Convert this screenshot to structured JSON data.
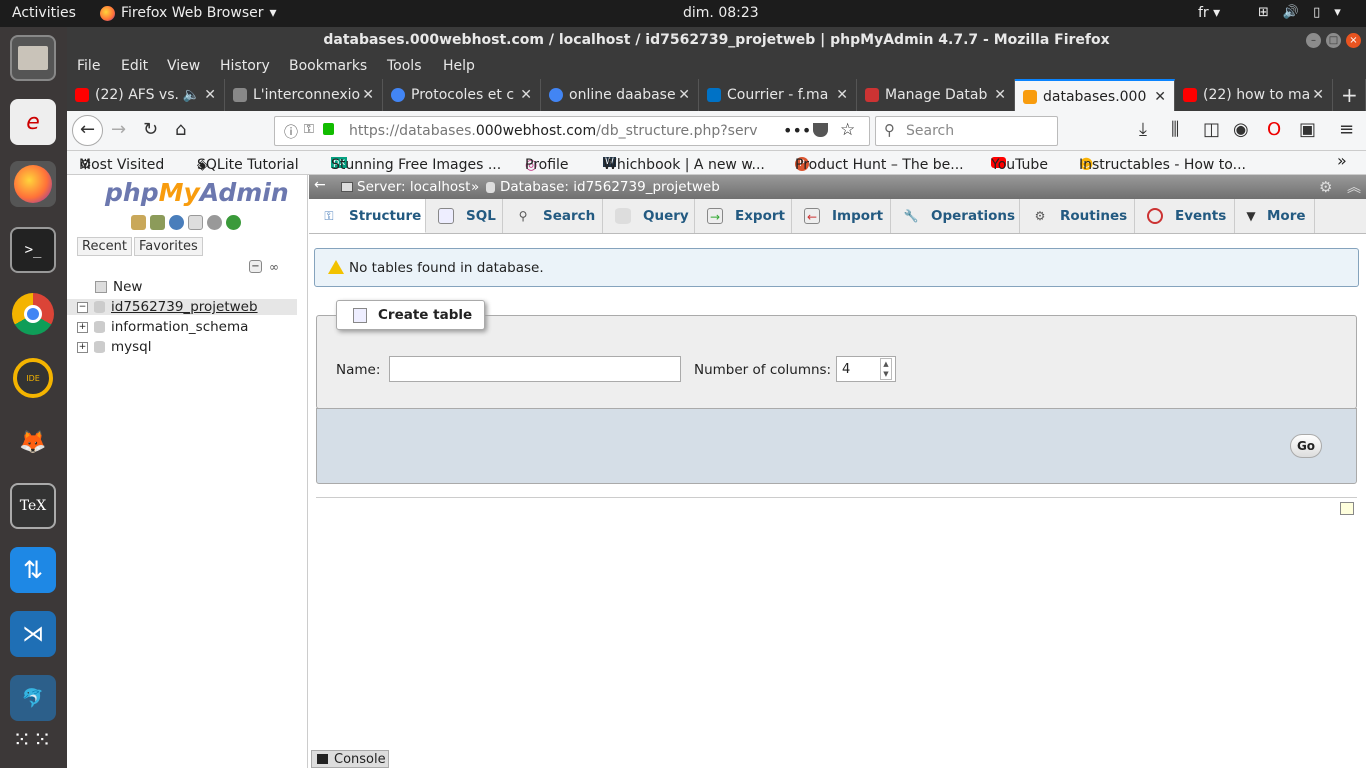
{
  "system": {
    "activities": "Activities",
    "app_name": "Firefox Web Browser",
    "clock": "dim. 08:23",
    "lang": "fr"
  },
  "window": {
    "title": "databases.000webhost.com / localhost / id7562739_projetweb | phpMyAdmin 4.7.7 - Mozilla Firefox"
  },
  "menu": [
    "File",
    "Edit",
    "View",
    "History",
    "Bookmarks",
    "Tools",
    "Help"
  ],
  "tabs": [
    {
      "label": "(22) AFS vs.",
      "icon_color": "#ff0000",
      "icon": "youtube-icon"
    },
    {
      "label": "L'interconnexio",
      "icon_color": "#888888",
      "icon": "page-icon"
    },
    {
      "label": "Protocoles et c",
      "icon_color": "#4285f4",
      "icon": "google-icon"
    },
    {
      "label": "online daabase",
      "icon_color": "#4285f4",
      "icon": "google-icon"
    },
    {
      "label": "Courrier - f.ma",
      "icon_color": "#0072c6",
      "icon": "outlook-icon"
    },
    {
      "label": "Manage Datab",
      "icon_color": "#cc3333",
      "icon": "page-icon"
    },
    {
      "label": "databases.000",
      "icon_color": "#f89c0e",
      "icon": "phpmyadmin-icon"
    },
    {
      "label": "(22) how to ma",
      "icon_color": "#ff0000",
      "icon": "youtube-icon"
    }
  ],
  "nav": {
    "url_prefix": "https://databases.",
    "url_host": "000webhost.com",
    "url_rest": "/db_structure.php?serv",
    "search_placeholder": "Search"
  },
  "bookmarks": [
    "Most Visited",
    "SQLite Tutorial",
    "Stunning Free Images ...",
    "Profile",
    "Whichbook | A new w...",
    "Product Hunt – The be...",
    "YouTube",
    "Instructables - How to..."
  ],
  "sidebar": {
    "logo_php": "php",
    "logo_my": "My",
    "logo_admin": "Admin",
    "recent": "Recent",
    "favorites": "Favorites",
    "tree": [
      "New",
      "id7562739_projetweb",
      "information_schema",
      "mysql"
    ]
  },
  "main": {
    "crumb_server": "Server: localhost",
    "crumb_sep": "»",
    "crumb_db": "Database: id7562739_projetweb",
    "tabs": [
      "Structure",
      "SQL",
      "Search",
      "Query",
      "Export",
      "Import",
      "Operations",
      "Routines",
      "Events",
      "More"
    ],
    "notice": "No tables found in database.",
    "create_table": "Create table",
    "name_label": "Name:",
    "name_value": "",
    "columns_label": "Number of columns:",
    "columns_value": "4",
    "go": "Go",
    "console": "Console"
  },
  "colors": {
    "accent": "#235a81",
    "notice_bg": "#ebf3f9",
    "firefox_blue": "#0a84ff",
    "pma_logo": "#6c78af"
  }
}
